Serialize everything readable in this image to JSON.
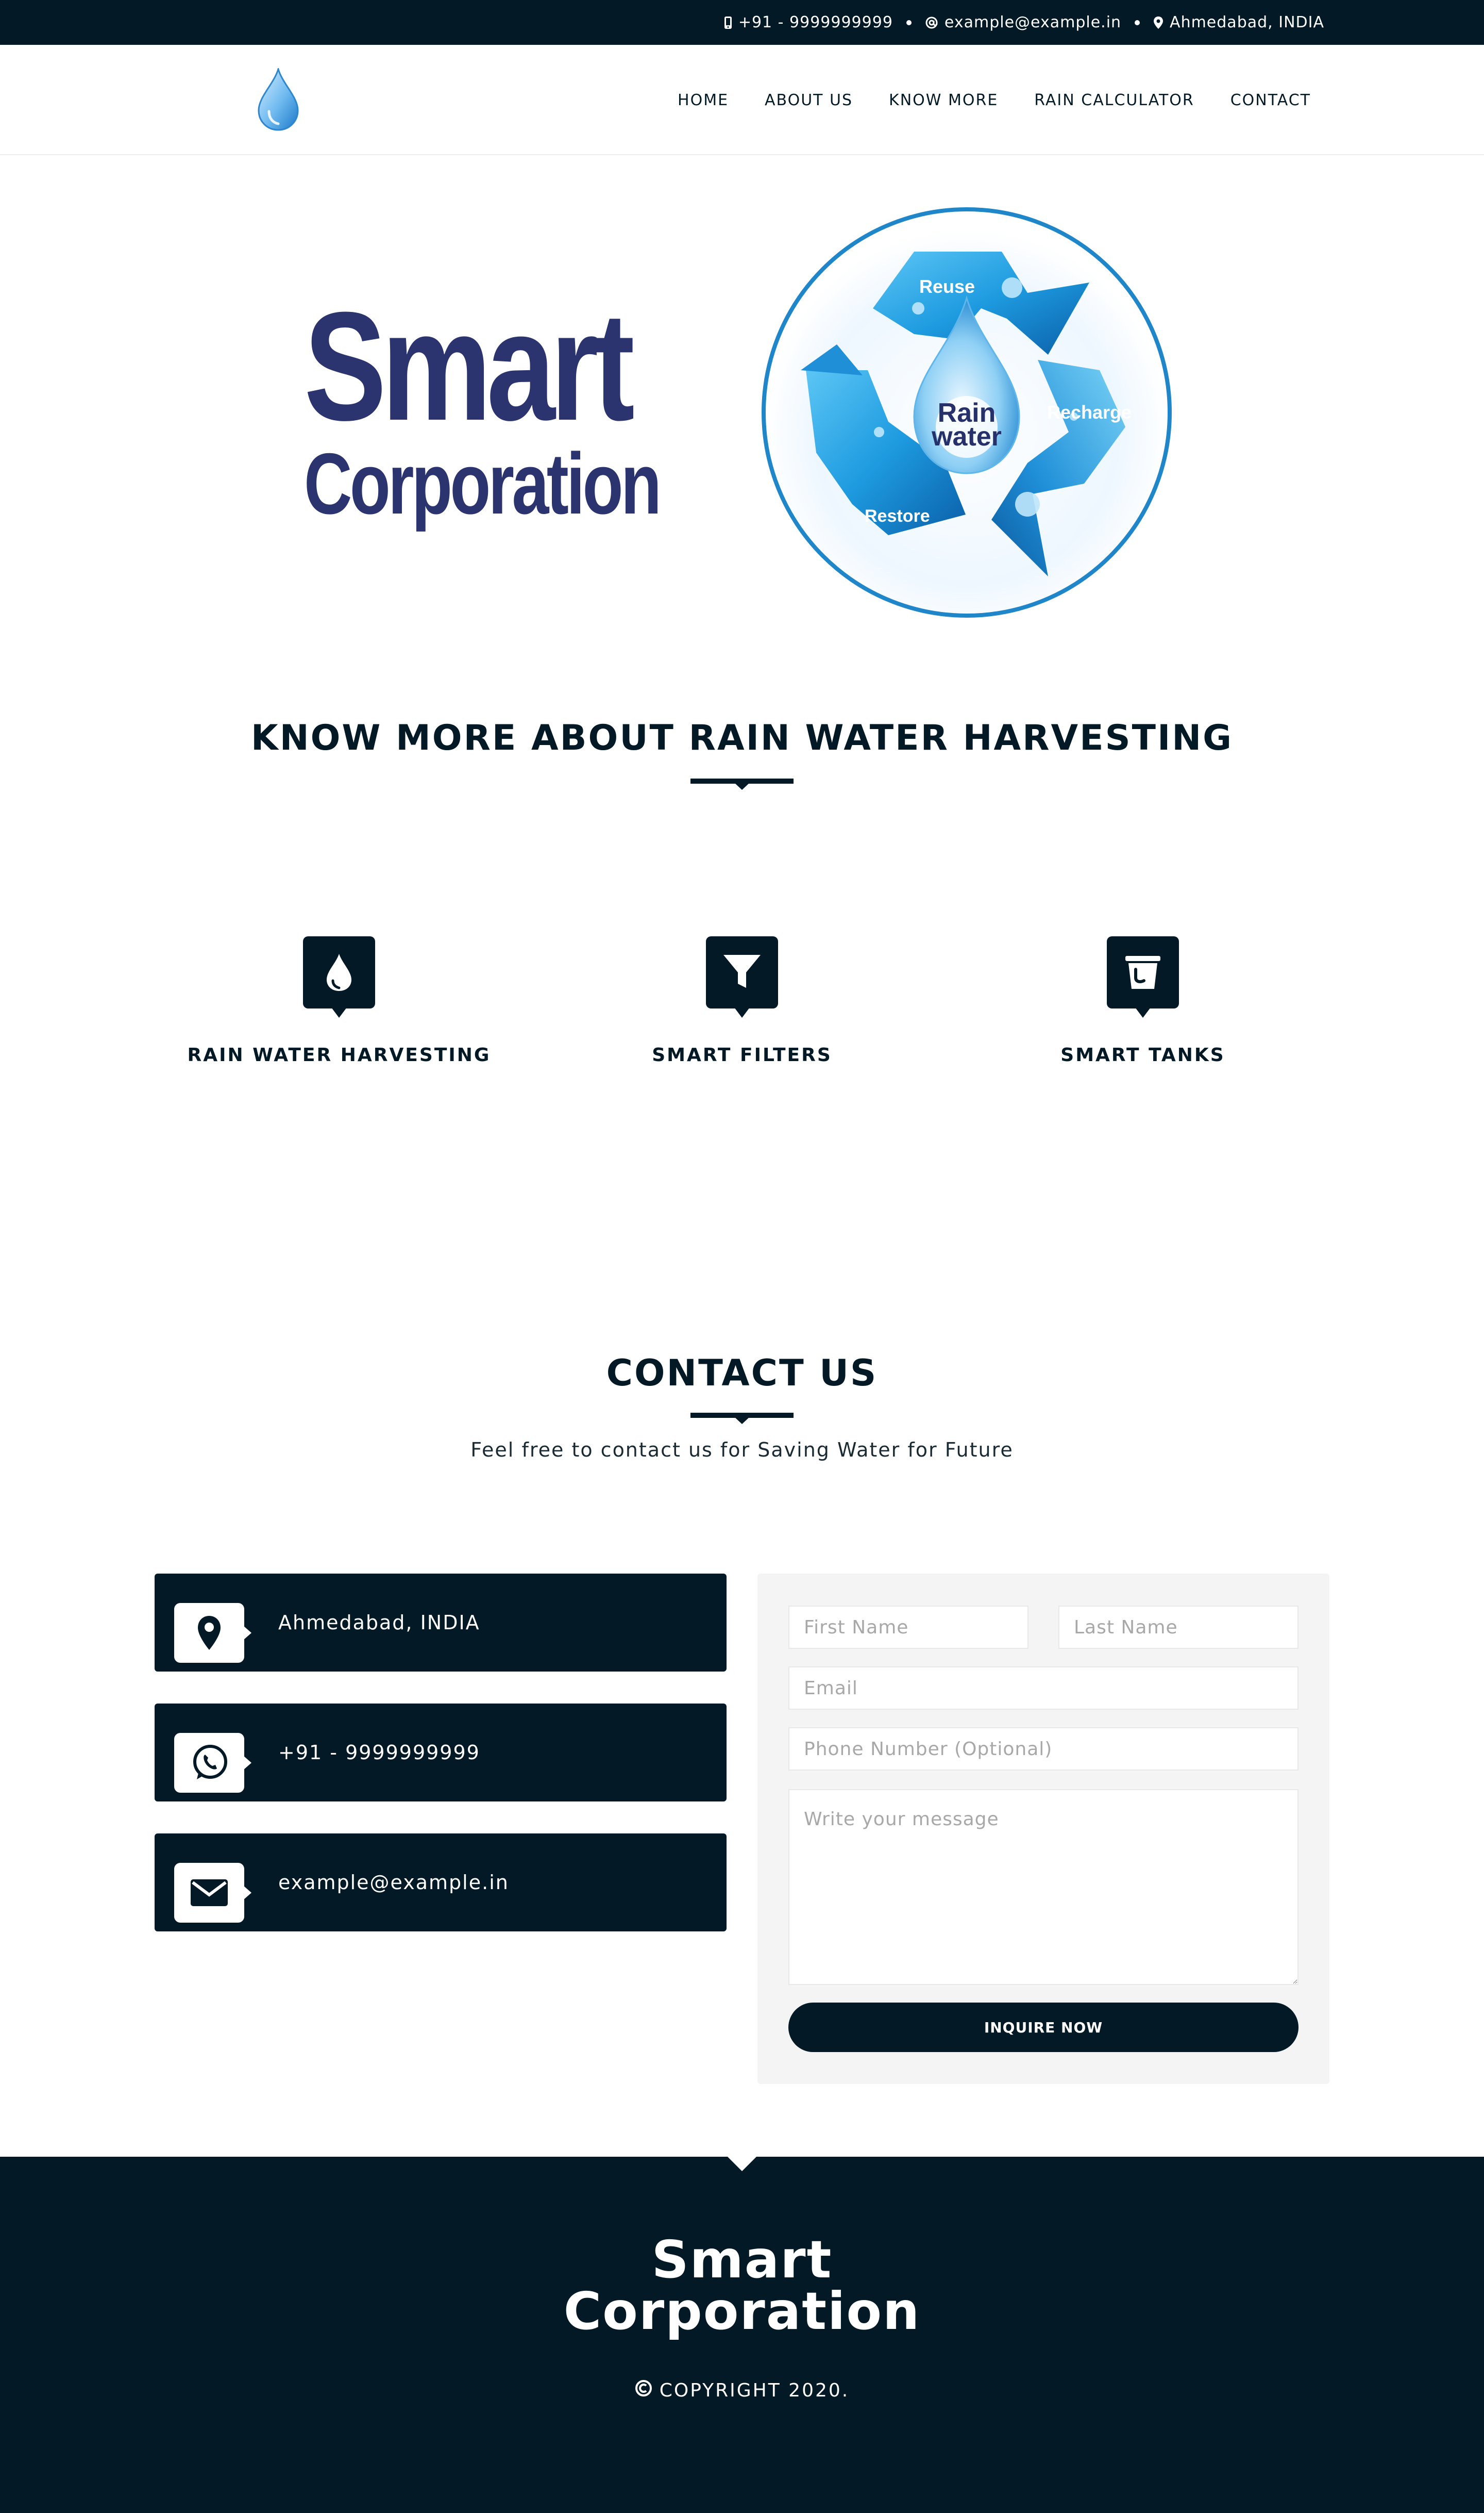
{
  "topbar": {
    "phone": "+91 - 9999999999",
    "email": "example@example.in",
    "location": "Ahmedabad, INDIA"
  },
  "nav": {
    "items": [
      "HOME",
      "ABOUT US",
      "KNOW MORE",
      "RAIN CALCULATOR",
      "CONTACT"
    ]
  },
  "hero": {
    "brand_line1": "Smart",
    "brand_line2": "Corporation",
    "graphic_labels": {
      "reuse": "Reuse",
      "recharge": "Recharge",
      "restore": "Restore",
      "center_line1": "Rain",
      "center_line2": "water"
    }
  },
  "know_more": {
    "title": "KNOW MORE ABOUT RAIN WATER HARVESTING",
    "features": [
      {
        "label": "RAIN WATER HARVESTING",
        "icon": "water-drop-icon"
      },
      {
        "label": "SMART FILTERS",
        "icon": "filter-icon"
      },
      {
        "label": "SMART TANKS",
        "icon": "bucket-icon"
      }
    ]
  },
  "contact": {
    "title": "CONTACT US",
    "subtitle": "Feel free to contact us for Saving Water for Future",
    "cards": [
      {
        "text": "Ahmedabad, INDIA",
        "icon": "map-pin-icon"
      },
      {
        "text": "+91 - 9999999999",
        "icon": "whatsapp-icon"
      },
      {
        "text": "example@example.in",
        "icon": "envelope-icon"
      }
    ],
    "form": {
      "first_name_placeholder": "First Name",
      "last_name_placeholder": "Last Name",
      "email_placeholder": "Email",
      "phone_placeholder": "Phone Number (Optional)",
      "message_placeholder": "Write your message",
      "submit_label": "INQUIRE NOW"
    }
  },
  "footer": {
    "brand_line1": "Smart",
    "brand_line2": "Corporation",
    "copyright": "COPYRIGHT 2020."
  },
  "colors": {
    "navy": "#031a26",
    "brand_blue": "#2c3470",
    "water_blue": "#1a8fd6"
  }
}
